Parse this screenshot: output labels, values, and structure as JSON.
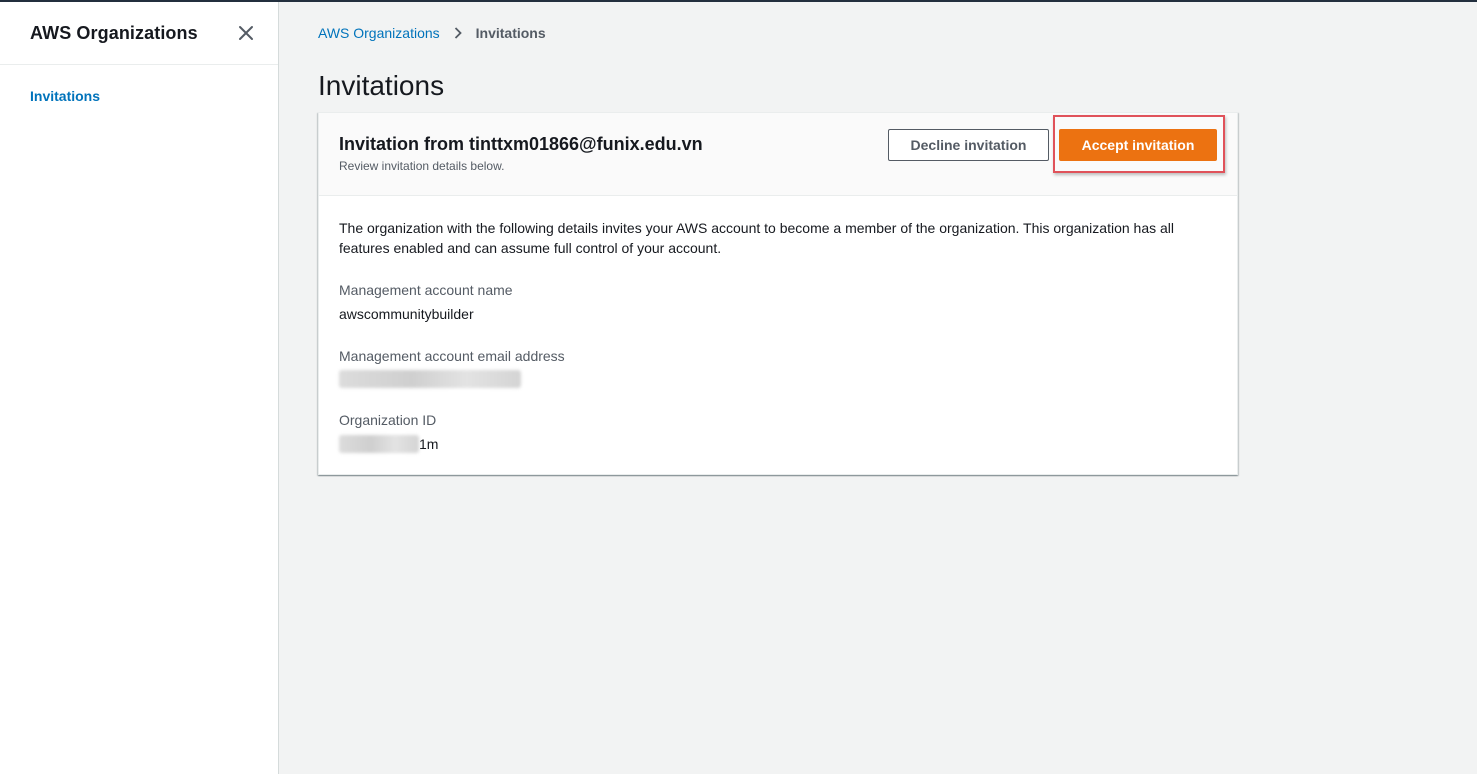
{
  "sidebar": {
    "title": "AWS Organizations",
    "close_icon": "close-icon",
    "items": [
      {
        "label": "Invitations",
        "active": true
      }
    ]
  },
  "breadcrumb": {
    "items": [
      {
        "label": "AWS Organizations"
      },
      {
        "label": "Invitations"
      }
    ],
    "separator_icon": "chevron-right-icon"
  },
  "page": {
    "title": "Invitations"
  },
  "invitation": {
    "title": "Invitation from tinttxm01866@funix.edu.vn",
    "description": "Review invitation details below.",
    "decline_label": "Decline invitation",
    "accept_label": "Accept invitation",
    "intro": "The organization with the following details invites your AWS account to become a member of the organization. This organization has all features enabled and can assume full control of your account.",
    "fields": [
      {
        "label": "Management account name",
        "value": "awscommunitybuilder"
      },
      {
        "label": "Management account email address",
        "value": "",
        "redacted": true
      },
      {
        "label": "Organization ID",
        "value": "1m",
        "redacted_prefix": true
      }
    ]
  },
  "colors": {
    "accent_link": "#0073bb",
    "primary_button": "#ec7211",
    "highlight_box": "#e0525a",
    "background": "#f2f3f3"
  }
}
